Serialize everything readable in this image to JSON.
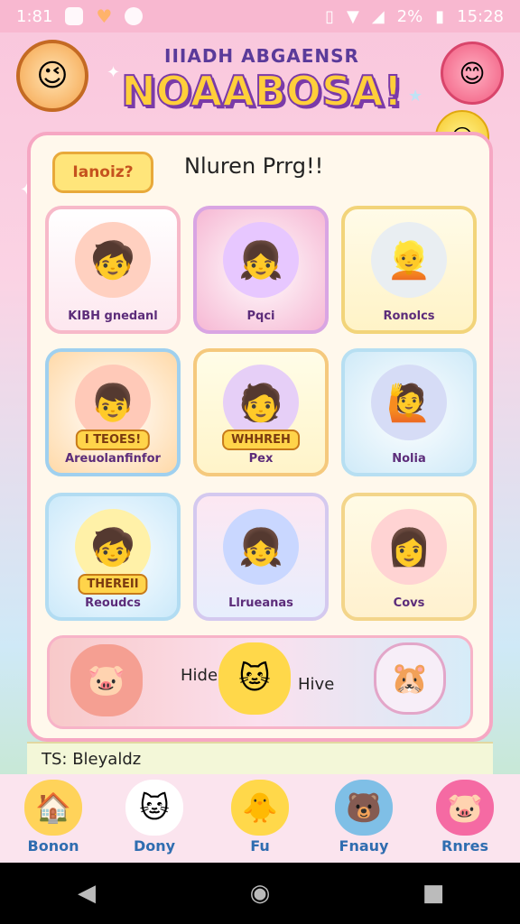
{
  "status": {
    "time_left": "1:81",
    "battery": "2%",
    "time_right": "15:28"
  },
  "header": {
    "subtitle": "IIIADH ABGAENSR",
    "title": "NOAABOSA!"
  },
  "panel": {
    "badge": "Ianoiz?",
    "heading": "Nluren Prrg!!"
  },
  "cards": [
    {
      "label": "KIBH gnedanl"
    },
    {
      "label": "Pqci"
    },
    {
      "label": "Ronolcs"
    },
    {
      "tag": "I TEOES!",
      "label": "Areuolanfinfor"
    },
    {
      "tag": "WHHREH",
      "label": "Pex"
    },
    {
      "label": "Nolia"
    },
    {
      "tag": "THEREII",
      "label": "Reoudcs"
    },
    {
      "label": "Llrueanas"
    },
    {
      "label": "Covs"
    }
  ],
  "pets": {
    "word_left": "Hide",
    "word_right": "Hive"
  },
  "footer_text": "TS: Bleyaldz",
  "tabs": [
    {
      "label": "Bonon",
      "icon": "house-icon"
    },
    {
      "label": "Dony",
      "icon": "cat-icon"
    },
    {
      "label": "Fu",
      "icon": "chick-icon"
    },
    {
      "label": "Fnauy",
      "icon": "bear-icon"
    },
    {
      "label": "Rnres",
      "icon": "pig-icon"
    }
  ],
  "colors": {
    "accent_pink": "#f6a7c3",
    "title_yellow": "#ffcf3a",
    "title_purple": "#7a3aa8"
  }
}
